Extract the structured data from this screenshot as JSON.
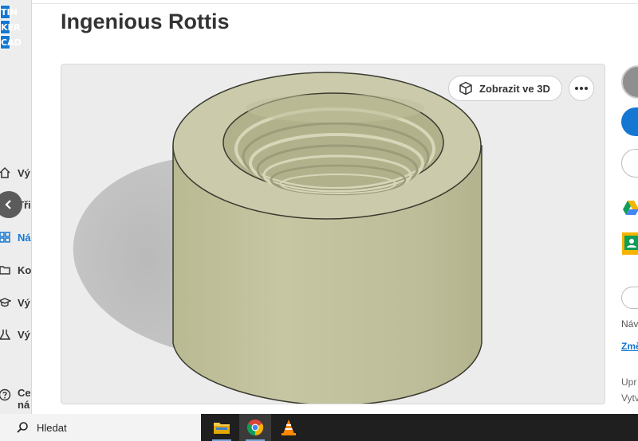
{
  "app": {
    "logo_letters": [
      "TIN",
      "KER",
      "CAD"
    ]
  },
  "sidebar": {
    "items": [
      {
        "label": "Vý",
        "icon": "home-icon"
      },
      {
        "label": "Tři",
        "icon": "settings-icon"
      },
      {
        "label": "Ná",
        "icon": "grid-icon"
      },
      {
        "label": "Ko",
        "icon": "folder-icon"
      },
      {
        "label": "Vý",
        "icon": "graduation-cap-icon"
      },
      {
        "label": "Vý",
        "icon": "flask-icon"
      },
      {
        "label": "Ce",
        "icon": "help-icon"
      }
    ],
    "last_item_second_line": "ná",
    "collapse_button": "chevron-left-icon"
  },
  "page": {
    "title": "Ingenious Rottis"
  },
  "preview": {
    "view3d_label": "Zobrazit ve 3D",
    "view3d_icon": "cube-icon",
    "more_icon": "more-horizontal-icon",
    "model_color": "#c9c9a6",
    "background_color": "#ececec"
  },
  "right_panel": {
    "label_nav": "Náv",
    "link_change": "Změ",
    "label_upr": "Upr",
    "label_vytv": "Vytv",
    "accent_color": "#1477d1"
  },
  "taskbar": {
    "search_placeholder": "Hledat",
    "search_icon": "search-icon",
    "apps": [
      {
        "name": "file-explorer",
        "icon": "folder-icon",
        "active": false
      },
      {
        "name": "chrome",
        "icon": "chrome-icon",
        "active": true,
        "badge": "0"
      },
      {
        "name": "vlc",
        "icon": "vlc-cone-icon",
        "active": false
      }
    ]
  }
}
